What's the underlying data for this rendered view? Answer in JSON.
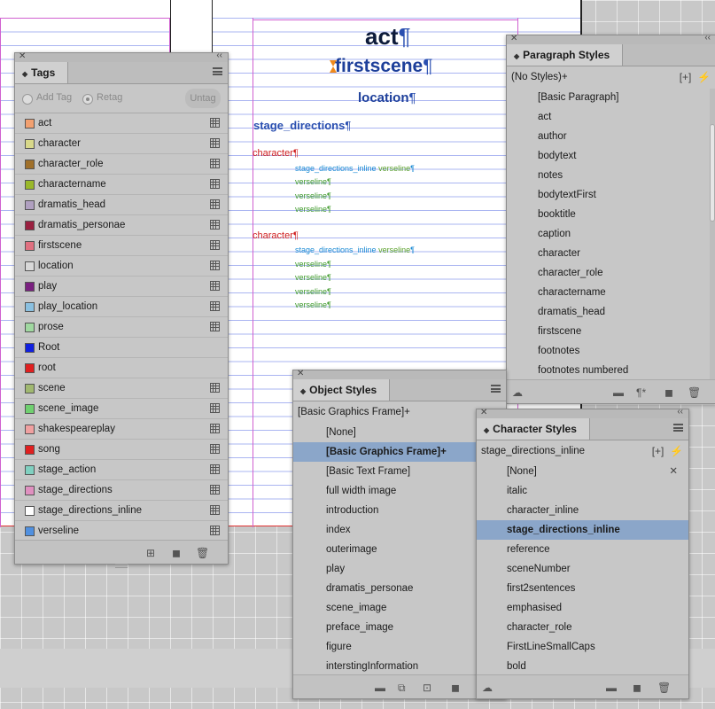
{
  "page_text": {
    "act": "act",
    "firstscene": "firstscene",
    "location": "location",
    "stage_directions": "stage_directions",
    "character": "character",
    "inline": "stage_directions_inline",
    "verseline": "verseline",
    "pilcrow": "¶"
  },
  "tags_panel": {
    "title": "Tags",
    "add_tag": "Add Tag",
    "retag": "Retag",
    "untag": "Untag",
    "items": [
      {
        "name": "act",
        "color": "#f2a070"
      },
      {
        "name": "character",
        "color": "#d8d88a"
      },
      {
        "name": "character_role",
        "color": "#a0702a"
      },
      {
        "name": "charactername",
        "color": "#9ab82a"
      },
      {
        "name": "dramatis_head",
        "color": "#b0a0c0"
      },
      {
        "name": "dramatis_personae",
        "color": "#9a2040"
      },
      {
        "name": "firstscene",
        "color": "#e07080"
      },
      {
        "name": "location",
        "color": "#d8d8d8"
      },
      {
        "name": "play",
        "color": "#7a2080"
      },
      {
        "name": "play_location",
        "color": "#8ac0e0"
      },
      {
        "name": "prose",
        "color": "#a0d8a0"
      },
      {
        "name": "Root",
        "color": "#1020e0"
      },
      {
        "name": "root",
        "color": "#e02020"
      },
      {
        "name": "scene",
        "color": "#a0b870"
      },
      {
        "name": "scene_image",
        "color": "#70d070"
      },
      {
        "name": "shakespeareplay",
        "color": "#f0a0a0"
      },
      {
        "name": "song",
        "color": "#e02020"
      },
      {
        "name": "stage_action",
        "color": "#80d0c0"
      },
      {
        "name": "stage_directions",
        "color": "#e090c0"
      },
      {
        "name": "stage_directions_inline",
        "color": "#ffffff"
      },
      {
        "name": "verseline",
        "color": "#5090e0"
      }
    ]
  },
  "paragraph_panel": {
    "title": "Paragraph Styles",
    "current": "(No Styles)+",
    "items": [
      "[Basic Paragraph]",
      "act",
      "author",
      "bodytext",
      "notes",
      "bodytextFirst",
      "booktitle",
      "caption",
      "character",
      "character_role",
      "charactername",
      "dramatis_head",
      "firstscene",
      "footnotes",
      "footnotes numbered"
    ]
  },
  "object_panel": {
    "title": "Object Styles",
    "current": "[Basic Graphics Frame]+",
    "selected_index": 1,
    "items": [
      "[None]",
      "[Basic Graphics Frame]+",
      "[Basic Text Frame]",
      "full width image",
      "introduction",
      "index",
      "outerimage",
      "play",
      "dramatis_personae",
      "scene_image",
      "preface_image",
      "figure",
      "interstingInformation"
    ]
  },
  "character_panel": {
    "title": "Character Styles",
    "current": "stage_directions_inline",
    "selected_index": 3,
    "items": [
      "[None]",
      "italic",
      "character_inline",
      "stage_directions_inline",
      "reference",
      "sceneNumber",
      "first2sentences",
      "emphasised",
      "character_role",
      "FirstLineSmallCaps",
      "bold"
    ]
  }
}
